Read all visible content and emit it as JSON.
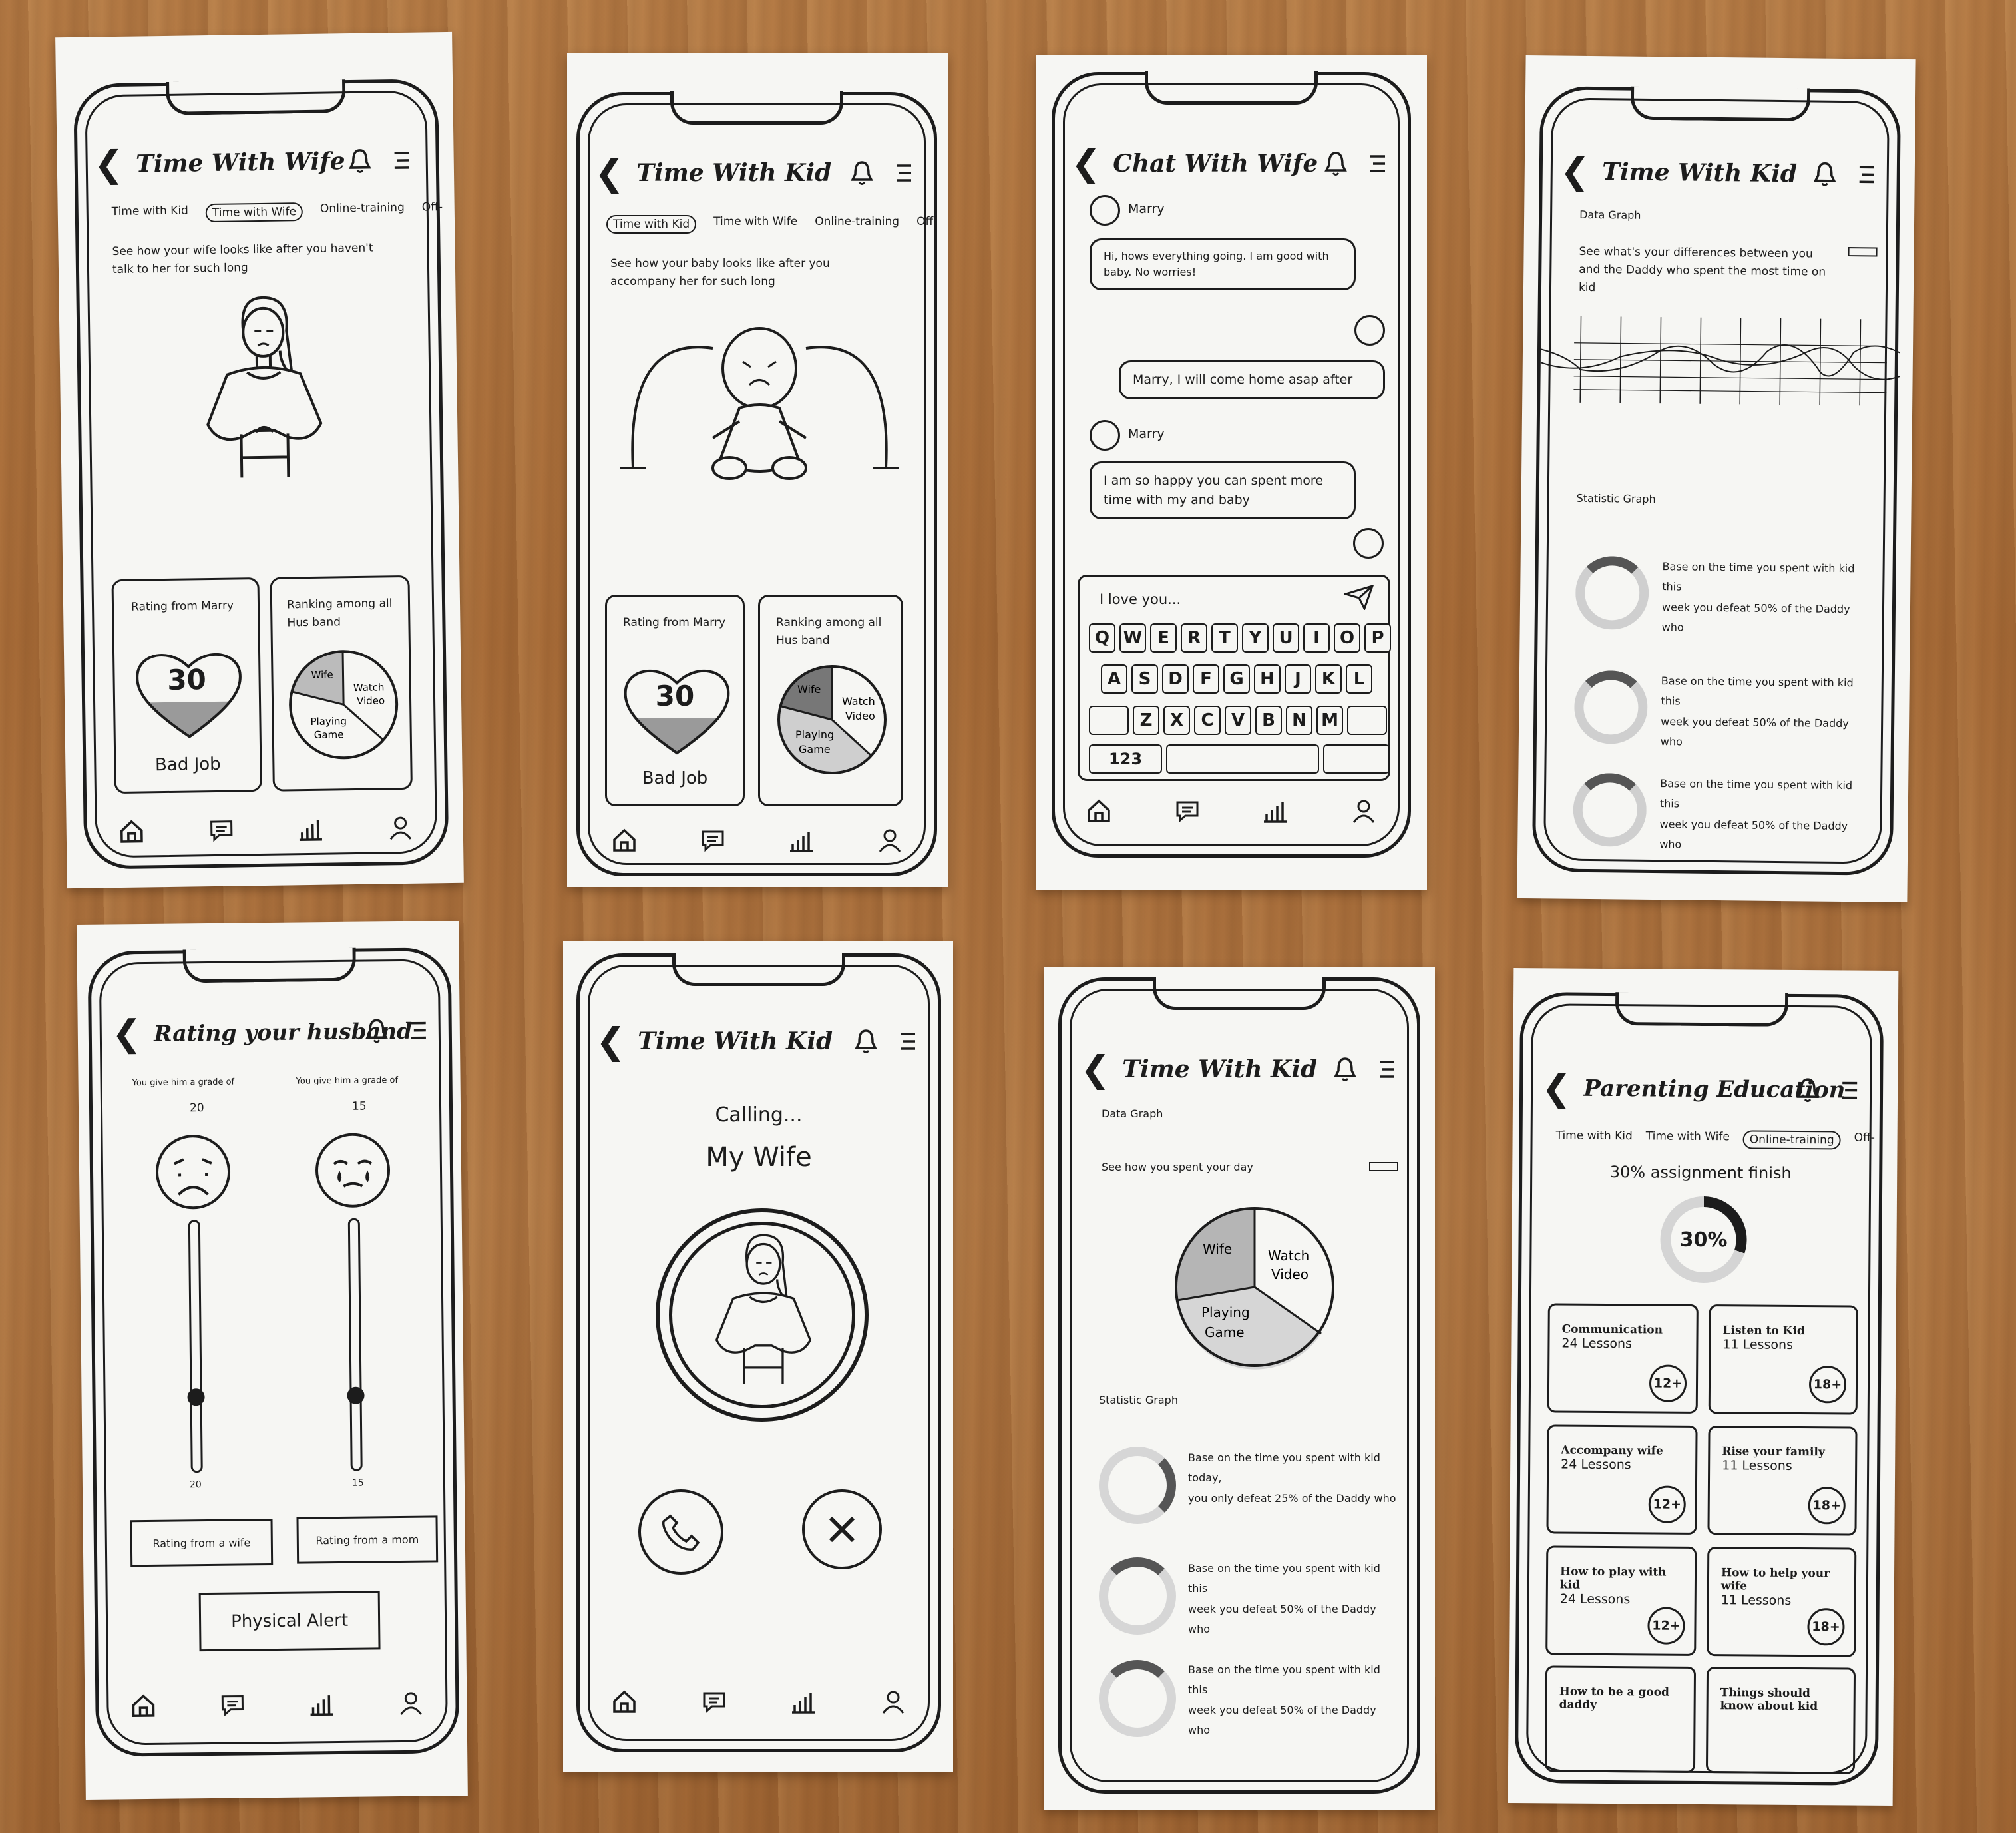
{
  "screens": {
    "wife": {
      "title": "Time With Wife",
      "tabs": [
        "Time with Kid",
        "Time with Wife",
        "Online-training",
        "Off-"
      ],
      "description": "See how your wife looks like after you haven't talk to her for such long",
      "rating_label": "Rating from Marry",
      "rating_value": "30",
      "rating_verdict": "Bad Job",
      "ranking_label": "Ranking among all Hus band",
      "pie_labels": [
        "Wife",
        "Watch Video",
        "Playing Game"
      ]
    },
    "kid": {
      "title": "Time With Kid",
      "tabs": [
        "Time with Kid",
        "Time with Wife",
        "Online-training",
        "Off-"
      ],
      "description": "See how your baby looks like after you accompany her for such long",
      "rating_label": "Rating from Marry",
      "rating_value": "30",
      "rating_verdict": "Bad Job",
      "ranking_label": "Ranking among all Hus band",
      "pie_labels": [
        "Wife",
        "Watch Video",
        "Playing Game"
      ]
    },
    "chat": {
      "title": "Chat With Wife",
      "sender": "Marry",
      "msg1": "Hi, hows everything going. I am good with baby. No worries!",
      "msg2": "Marry, I will come home asap after",
      "msg3": "I am so happy you can spent more time with my and baby",
      "input_value": "I love you...",
      "row1": [
        "Q",
        "W",
        "E",
        "R",
        "T",
        "Y",
        "U",
        "I",
        "O",
        "P"
      ],
      "row2": [
        "A",
        "S",
        "D",
        "F",
        "G",
        "H",
        "J",
        "K",
        "L"
      ],
      "row3": [
        "Z",
        "X",
        "C",
        "V",
        "B",
        "N",
        "M"
      ],
      "num_key": "123"
    },
    "stats1": {
      "title": "Time With Kid",
      "data_graph": "Data Graph",
      "graph_desc": "See what's your differences between you and the Daddy who spent the most time on kid",
      "statistic_graph": "Statistic Graph",
      "stat_line1": "Base on the time you spent with kid",
      "stat_line2": "this",
      "stat_line3": "week you defeat 50% of the Daddy who"
    },
    "rating": {
      "title": "Rating your husband",
      "grade_label": "You give him a grade of",
      "left_grade": "20",
      "right_grade": "15",
      "left_level": 0.3,
      "right_level": 0.3,
      "btn_wife": "Rating from a wife",
      "btn_mom": "Rating from a mom",
      "btn_alert": "Physical Alert"
    },
    "calling": {
      "title": "Time With Kid",
      "status": "Calling...",
      "callee": "My Wife"
    },
    "stats2": {
      "title": "Time With Kid",
      "data_graph": "Data Graph",
      "graph_desc": "See how you spent your day",
      "pie_labels": [
        "Wife",
        "Watch Video",
        "Playing Game"
      ],
      "statistic_graph": "Statistic Graph",
      "s1_line1": "Base on the time you spent with kid",
      "s1_line2": "today,",
      "s1_line3": "you only defeat 25% of the Daddy who",
      "s2_line1": "Base on the time you spent with kid",
      "s2_line2": "this",
      "s2_line3": "week you defeat 50% of the Daddy who"
    },
    "education": {
      "title": "Parenting Education",
      "tabs": [
        "Time with Kid",
        "Time with Wife",
        "Online-training",
        "Off-"
      ],
      "progress_title": "30% assignment finish",
      "progress_value": "30%",
      "progress": 0.3,
      "lessons": [
        {
          "title": "Communication",
          "count": "24 Lessons",
          "age": "12+"
        },
        {
          "title": "Listen to Kid",
          "count": "11 Lessons",
          "age": "18+"
        },
        {
          "title": "Accompany wife",
          "count": "24 Lessons",
          "age": "12+"
        },
        {
          "title": "Rise your family",
          "count": "11 Lessons",
          "age": "18+"
        },
        {
          "title": "How to play with kid",
          "count": "24 Lessons",
          "age": "12+"
        },
        {
          "title": "How to help your wife",
          "count": "11 Lessons",
          "age": "18+"
        },
        {
          "title": "How to be a good daddy",
          "count": "",
          "age": ""
        },
        {
          "title": "Things should know about kid",
          "count": "",
          "age": ""
        }
      ]
    }
  }
}
